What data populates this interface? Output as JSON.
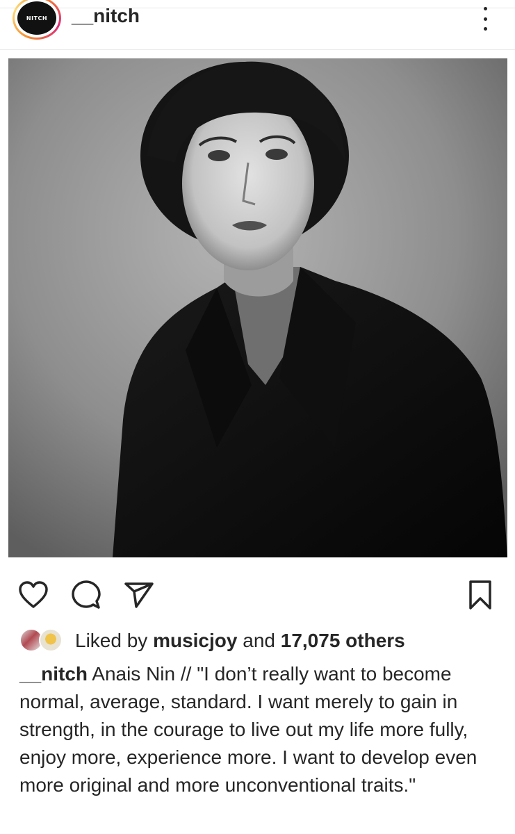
{
  "post": {
    "avatar_text": "NITCH",
    "username": "__nitch",
    "more_icon": "more-vertical-icon"
  },
  "photo": {
    "subject": "black-and-white portrait photo"
  },
  "actions": {
    "like_icon": "heart-icon",
    "comment_icon": "comment-icon",
    "share_icon": "send-icon",
    "save_icon": "bookmark-icon"
  },
  "likes": {
    "prefix": "Liked by",
    "user": "musicjoy",
    "middle": "and",
    "count": "17,075 others"
  },
  "caption": {
    "username": "__nitch",
    "text": "Anais Nin // \"I don’t really want to become normal, average, standard. I want merely to gain in strength, in the courage to live out my life more fully, enjoy more, experience more. I want to develop even more original and more unconventional traits.\""
  },
  "colors": {
    "text": "#262626",
    "ring_orange": "#f58529",
    "ring_pink": "#dd2a7b"
  }
}
